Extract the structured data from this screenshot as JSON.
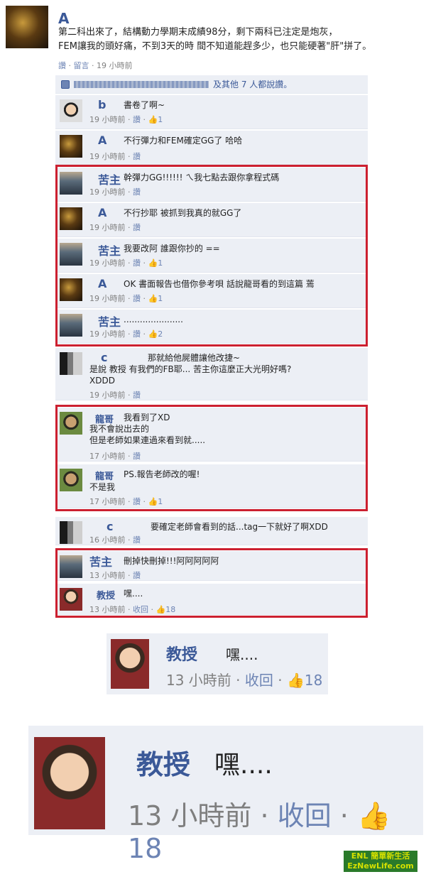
{
  "post": {
    "author": "A",
    "body": "第二科出來了，結構動力學期末成績98分，剩下兩科已注定是炮灰，\nFEM讓我的頭好痛，不到3天的時 間不知道能趕多少，也只能硬著\"肝\"拼了。",
    "like_label": "讚",
    "comment_label": "留言",
    "time": "19 小時前"
  },
  "likes_bar": {
    "suffix": "及其他 7 人都說讚。"
  },
  "comments": [
    {
      "name": "b",
      "text": "書卷了啊~",
      "time": "19 小時前",
      "like_label": "讚",
      "count": "1"
    },
    {
      "name": "A",
      "text": "不行彈力和FEM確定GG了 哈哈",
      "time": "19 小時前",
      "like_label": "讚",
      "count": ""
    },
    {
      "name": "苦主",
      "text": "幹彈力GG!!!!!! ㄟ我七點去跟你拿程式碼",
      "time": "19 小時前",
      "like_label": "讚",
      "count": ""
    },
    {
      "name": "A",
      "text": "不行抄耶 被抓到我真的就GG了",
      "time": "19 小時前",
      "like_label": "讚",
      "count": ""
    },
    {
      "name": "苦主",
      "text": "我要改阿 誰跟你抄的 ==",
      "time": "19 小時前",
      "like_label": "讚",
      "count": "1"
    },
    {
      "name": "A",
      "text": "OK 書面報告也借你參考唄 話說龍哥看的到這篇 蔫",
      "time": "19 小時前",
      "like_label": "讚",
      "count": "1"
    },
    {
      "name": "苦主",
      "text": "......................",
      "time": "19 小時前",
      "like_label": "讚",
      "count": "2"
    },
    {
      "name": "c",
      "text": "那就給他屍體讓他改捷~",
      "text2": "是說  教授  有我們的FB耶... 苦主你這麼正大光明好嗎?\nXDDD",
      "time": "19 小時前",
      "like_label": "讚",
      "count": ""
    },
    {
      "name": "龍哥",
      "text": "我看到了XD",
      "text2": "我不會說出去的\n但是老師如果連過來看到就.....",
      "time": "17 小時前",
      "like_label": "讚",
      "count": ""
    },
    {
      "name": "龍哥",
      "text": "PS.報告老師改的喔!",
      "text2": "不是我",
      "time": "17 小時前",
      "like_label": "讚",
      "count": "1"
    },
    {
      "name": "c",
      "text": "要確定老師會看到的話...tag一下就好了啊XDD",
      "time": "16 小時前",
      "like_label": "讚",
      "count": ""
    },
    {
      "name": "苦主",
      "text": "刪掉快刪掉!!!阿阿阿阿阿",
      "time": "13 小時前",
      "like_label": "讚",
      "count": ""
    },
    {
      "name": "教授",
      "text": "嘿....",
      "time": "13 小時前",
      "like_label": "收回",
      "count": "18"
    }
  ],
  "zoom": {
    "name": "教授",
    "text": "嘿....",
    "time": "13 小時前",
    "action": "收回",
    "count": "18"
  },
  "watermark": {
    "line1": "ENL 簡單新生活",
    "line2": "EzNewLife.com"
  },
  "colors": {
    "brand": "#3b5998",
    "highlight": "#cc2030",
    "comment_bg": "#eceff5"
  }
}
